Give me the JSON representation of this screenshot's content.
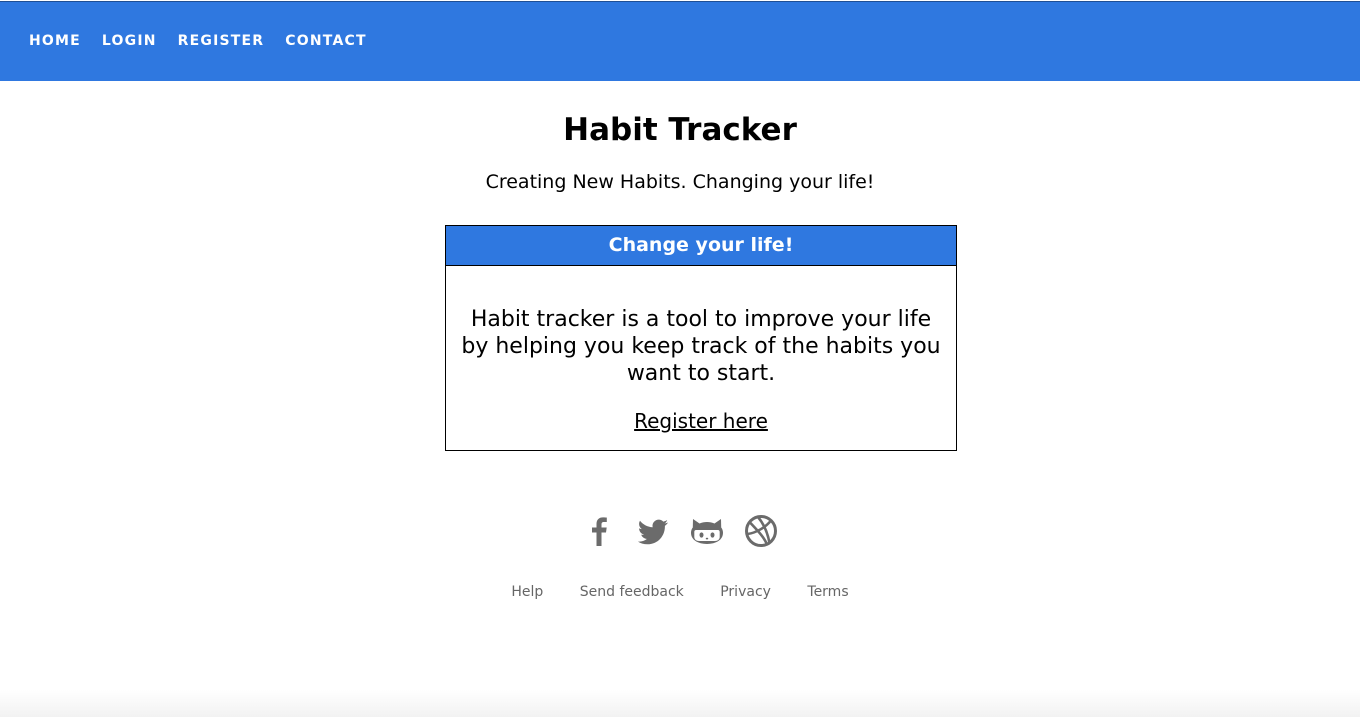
{
  "nav": {
    "items": [
      {
        "label": "HOME"
      },
      {
        "label": "LOGIN"
      },
      {
        "label": "REGISTER"
      },
      {
        "label": "CONTACT"
      }
    ]
  },
  "header": {
    "title": "Habit Tracker",
    "subtitle": "Creating New Habits. Changing your life!"
  },
  "card": {
    "heading": "Change your life!",
    "body": "Habit tracker is a tool to improve your life by helping you keep track of the habits you want to start.",
    "link_label": "Register here"
  },
  "social": {
    "icons": [
      "facebook-icon",
      "twitter-icon",
      "github-icon",
      "dribbble-icon"
    ]
  },
  "footer": {
    "links": [
      {
        "label": "Help"
      },
      {
        "label": "Send feedback"
      },
      {
        "label": "Privacy"
      },
      {
        "label": "Terms"
      }
    ]
  },
  "colors": {
    "accent": "#2f78e0",
    "icon_gray": "#6b6b6b",
    "footer_text": "#666666"
  }
}
